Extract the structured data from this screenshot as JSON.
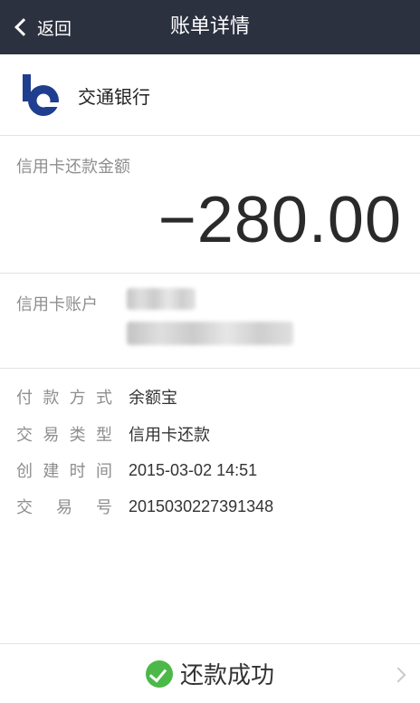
{
  "header": {
    "back_label": "返回",
    "title": "账单详情"
  },
  "bank": {
    "name": "交通银行",
    "logo_color": "#1f3e8f"
  },
  "amount": {
    "label": "信用卡还款金额",
    "value": "−280.00"
  },
  "account": {
    "label": "信用卡账户"
  },
  "details": [
    {
      "key": "付款方式",
      "value": "余额宝"
    },
    {
      "key": "交易类型",
      "value": "信用卡还款"
    },
    {
      "key": "创建时间",
      "value": "2015-03-02 14:51"
    },
    {
      "key": "交易号",
      "value": "2015030227391348"
    }
  ],
  "footer": {
    "status": "还款成功",
    "status_color": "#4cb848"
  },
  "colors": {
    "header_bg": "#2c3140"
  }
}
